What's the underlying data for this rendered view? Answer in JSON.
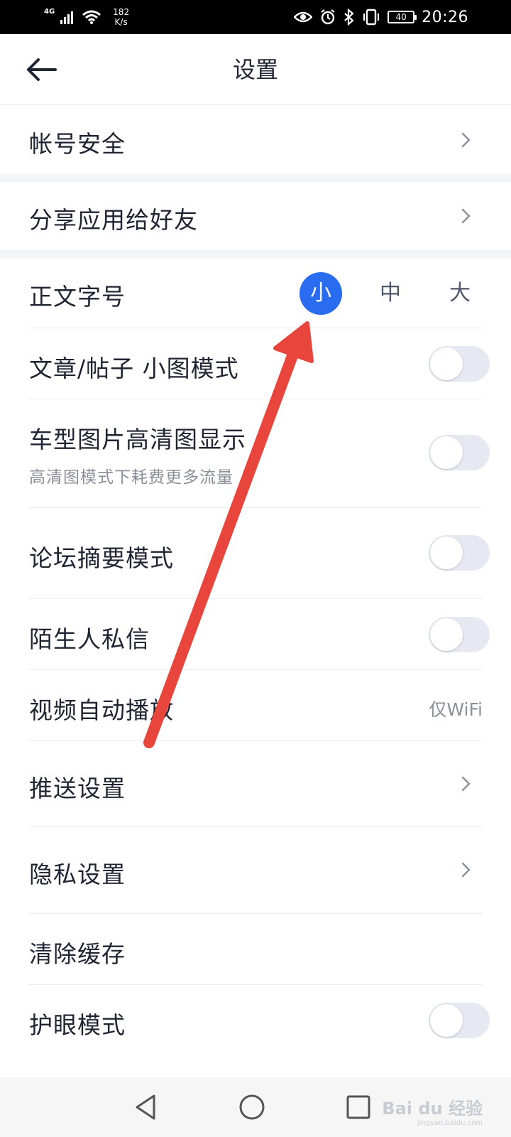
{
  "status_bar": {
    "network": "4G",
    "speed_value": "182",
    "speed_unit": "K/s",
    "battery": "40",
    "time": "20:26"
  },
  "header": {
    "title": "设置"
  },
  "rows": {
    "account": {
      "label": "帐号安全"
    },
    "share": {
      "label": "分享应用给好友"
    },
    "font_size": {
      "label": "正文字号",
      "options": [
        "小",
        "中",
        "大"
      ],
      "selected": "小"
    },
    "small_image": {
      "label": "文章/帖子 小图模式",
      "enabled": false
    },
    "hd_image": {
      "label": "车型图片高清图显示",
      "sub": "高清图模式下耗费更多流量",
      "enabled": false
    },
    "forum_summary": {
      "label": "论坛摘要模式",
      "enabled": false
    },
    "stranger_msg": {
      "label": "陌生人私信",
      "enabled": false
    },
    "video_autoplay": {
      "label": "视频自动播放",
      "value": "仅WiFi"
    },
    "push": {
      "label": "推送设置"
    },
    "privacy": {
      "label": "隐私设置"
    },
    "clear_cache": {
      "label": "清除缓存"
    },
    "eye_care": {
      "label": "护眼模式",
      "enabled": false
    }
  },
  "colors": {
    "accent": "#2a6cf0",
    "annotation_arrow": "#e8453c"
  },
  "watermark": {
    "brand": "Bai du 经验",
    "domain": "jingyan.baidu.com"
  }
}
